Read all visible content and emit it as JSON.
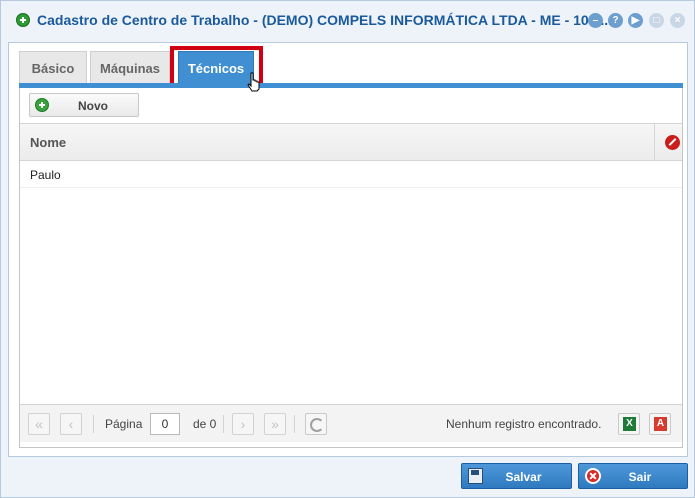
{
  "window": {
    "title": "Cadastro de Centro de Trabalho - (DEMO) COMPELS INFORMÁTICA LTDA - ME - 10.8..."
  },
  "title_tools": [
    {
      "icon": "minimize-icon",
      "glyph": "–"
    },
    {
      "icon": "help-icon",
      "glyph": "?"
    },
    {
      "icon": "play-icon",
      "glyph": "▶"
    },
    {
      "icon": "maximize-icon",
      "glyph": "□"
    },
    {
      "icon": "close-icon",
      "glyph": "×"
    }
  ],
  "tabs": [
    {
      "label": "Básico",
      "active": false
    },
    {
      "label": "Máquinas",
      "active": false
    },
    {
      "label": "Técnicos",
      "active": true
    }
  ],
  "toolbar": {
    "new_label": "Novo"
  },
  "grid": {
    "columns": [
      "Nome"
    ],
    "rows": [
      {
        "nome": "Paulo"
      }
    ]
  },
  "pager": {
    "page_label": "Página",
    "page_value": "0",
    "of_label": "de 0",
    "status": "Nenhum registro encontrado."
  },
  "footer": {
    "save_label": "Salvar",
    "exit_label": "Sair"
  },
  "colors": {
    "accent": "#3f8fd2",
    "title": "#1a5a9c",
    "highlight": "#d00012"
  }
}
